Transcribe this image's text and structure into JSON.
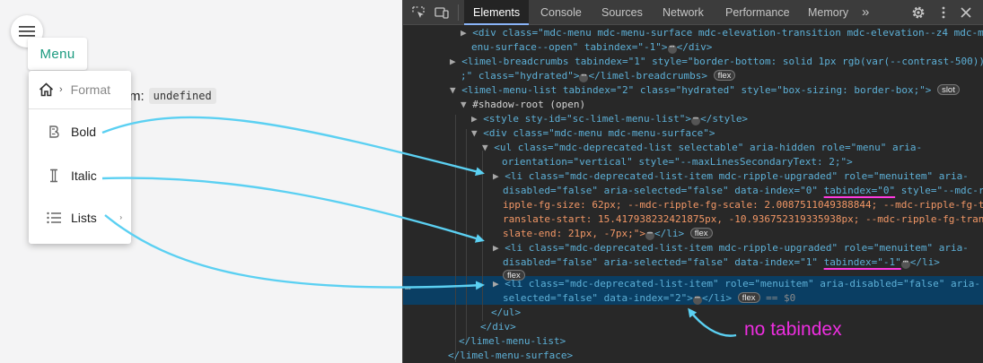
{
  "app": {
    "menu_button_label": "Menu",
    "behind_text": "m:",
    "behind_code": "undefined",
    "breadcrumb": {
      "home_icon": "home-icon",
      "separator": "›",
      "label": "Format"
    },
    "menu_items": [
      {
        "label": "Bold",
        "icon": "bold-icon"
      },
      {
        "label": "Italic",
        "icon": "italic-icon"
      },
      {
        "label": "Lists",
        "icon": "list-icon",
        "submenu_chevron": "›"
      }
    ]
  },
  "devtools": {
    "tabs": [
      "Elements",
      "Console",
      "Sources",
      "Network",
      "Performance",
      "Memory"
    ],
    "more_tabs": "»",
    "active_tab": "Elements",
    "lines": {
      "l1a": "<div class=\"mdc-menu mdc-menu-surface mdc-elevation-transition mdc-elevation--z4 mdc-m",
      "l1b": "enu-surface--open\" tabindex=\"-1\">",
      "l1c": "</div>",
      "l2a": "<limel-breadcrumbs tabindex=\"1\" style=\"border-bottom: solid 1px rgb(var(--contrast-500))",
      "l2b": ";\" class=\"hydrated\">",
      "l2c": "</limel-breadcrumbs>",
      "l3a": "<limel-menu-list tabindex=\"2\" class=\"hydrated\" style=\"box-sizing: border-box;\">",
      "shadow_root": "#shadow-root (open)",
      "style_a": "<style sty-id=\"sc-limel-menu-list\">",
      "style_b": "</style>",
      "div_open": "<div class=\"mdc-menu mdc-menu-surface\">",
      "ul_a": "<ul class=\"mdc-deprecated-list selectable\" aria-hidden role=\"menu\" aria-",
      "ul_b": "orientation=\"vertical\" style=\"--maxLinesSecondaryText: 2;\">",
      "li0_a": "<li class=\"mdc-deprecated-list-item mdc-ripple-upgraded\" role=\"menuitem\" aria-",
      "li0_b1": "disabled=\"false\" aria-selected=\"false\" data-index=\"0\" ",
      "li0_b2": "tabindex=\"0\"",
      "li0_b3": " style=\"--mdc-r",
      "li0_c": "ipple-fg-size: 62px; --mdc-ripple-fg-scale: 2.0087511049388844; --mdc-ripple-fg-t",
      "li0_d": "ranslate-start: 15.417938232421875px, -10.936752319335938px; --mdc-ripple-fg-tran",
      "li0_e": "slate-end: 21px, -7px;\">",
      "li0_f": "</li>",
      "li1_a": "<li class=\"mdc-deprecated-list-item mdc-ripple-upgraded\" role=\"menuitem\" aria-",
      "li1_b1": "disabled=\"false\" aria-selected=\"false\" data-index=\"1\" ",
      "li1_b2": "tabindex=\"-1\"",
      "li1_b3": "</li>",
      "li2_a": "<li class=\"mdc-deprecated-list-item\" role=\"menuitem\" aria-disabled=\"false\" aria-",
      "li2_b": "selected=\"false\" data-index=\"2\">",
      "li2_c": "</li>",
      "li2_eq": "== $0",
      "ul_close": "</ul>",
      "div_close": "</div>",
      "menu_list_close": "</limel-menu-list>",
      "surface_close": "</limel-menu-surface>"
    },
    "badges": {
      "flex": "flex",
      "slot": "slot",
      "ellipsis": "⋯"
    }
  },
  "annotation": {
    "note": "no tabindex",
    "color": "#ee2ee0",
    "arrow_color": "#5bd0f2"
  }
}
